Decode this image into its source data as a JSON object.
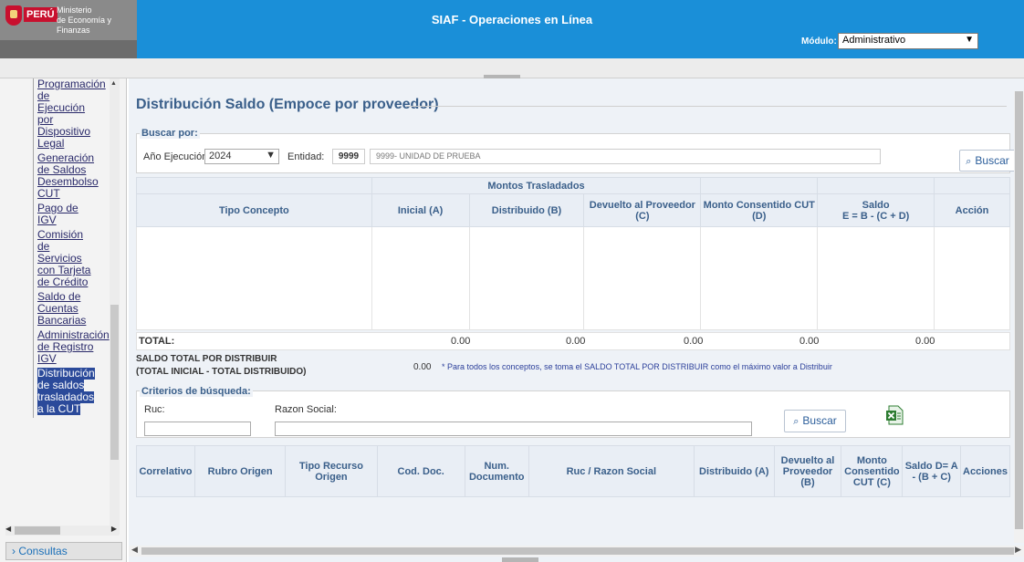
{
  "header": {
    "logo_country": "PERÚ",
    "logo_ministry_line1": "Ministerio",
    "logo_ministry_line2": "de Economía y Finanzas",
    "title": "SIAF - Operaciones en Línea",
    "module_label": "Módulo:",
    "module_value": "Administrativo"
  },
  "sidebar": {
    "items": [
      {
        "lines": [
          "Programación",
          "de",
          "Ejecución",
          "por",
          "Dispositivo",
          "Legal"
        ]
      },
      {
        "lines": [
          "Generación",
          "de Saldos",
          "Desembolso",
          "CUT"
        ]
      },
      {
        "lines": [
          "Pago de",
          "IGV"
        ]
      },
      {
        "lines": [
          "Comisión",
          "de",
          "Servicios",
          "con Tarjeta",
          "de Crédito"
        ]
      },
      {
        "lines": [
          "Saldo de",
          "Cuentas",
          "Bancarias"
        ]
      },
      {
        "lines": [
          "Administración",
          "de Registro",
          "IGV"
        ]
      },
      {
        "lines": [
          "Distribución",
          "de saldos",
          "trasladados",
          "a la CUT"
        ]
      }
    ],
    "consultas": "Consultas"
  },
  "main": {
    "title": "Distribución Saldo (Empoce por proveedor)",
    "buscar_por": "Buscar por:",
    "anio_label": "Año Ejecución:",
    "anio_value": "2024",
    "entidad_label": "Entidad:",
    "entidad_code": "9999",
    "entidad_name": "9999- UNIDAD DE PRUEBA",
    "buscar_button": "Buscar",
    "summary": {
      "group_header": "Montos Trasladados",
      "columns": {
        "tipo": "Tipo Concepto",
        "inicial": "Inicial (A)",
        "distribuido": "Distribuido (B)",
        "devuelto": "Devuelto al Proveedor (C)",
        "consentido": "Monto Consentido CUT (D)",
        "saldo_line1": "Saldo",
        "saldo_line2": "E = B - (C + D)",
        "accion": "Acción"
      },
      "total_label": "TOTAL:",
      "totals": [
        "0.00",
        "0.00",
        "0.00",
        "0.00",
        "0.00"
      ]
    },
    "saldo_title": "SALDO TOTAL POR DISTRIBUIR",
    "saldo_sub": "(TOTAL INICIAL - TOTAL DISTRIBUIDO)",
    "saldo_value": "0.00",
    "saldo_note": "* Para todos los conceptos, se toma el SALDO TOTAL POR DISTRIBUIR como el máximo valor a Distribuir",
    "criterios": "Criterios de búsqueda:",
    "ruc_label": "Ruc:",
    "razon_label": "Razon Social:",
    "buscar_button2": "Buscar",
    "detail_columns": {
      "correlativo": "Correlativo",
      "rubro": "Rubro Origen",
      "tipo_recurso": "Tipo Recurso Origen",
      "cod_doc": "Cod. Doc.",
      "num_doc": "Num. Documento",
      "ruc_razon": "Ruc / Razon Social",
      "distribuido": "Distribuido (A)",
      "devuelto": "Devuelto al Proveedor (B)",
      "consentido": "Monto Consentido CUT (C)",
      "saldo": "Saldo D= A - (B + C)",
      "acciones": "Acciones"
    }
  }
}
